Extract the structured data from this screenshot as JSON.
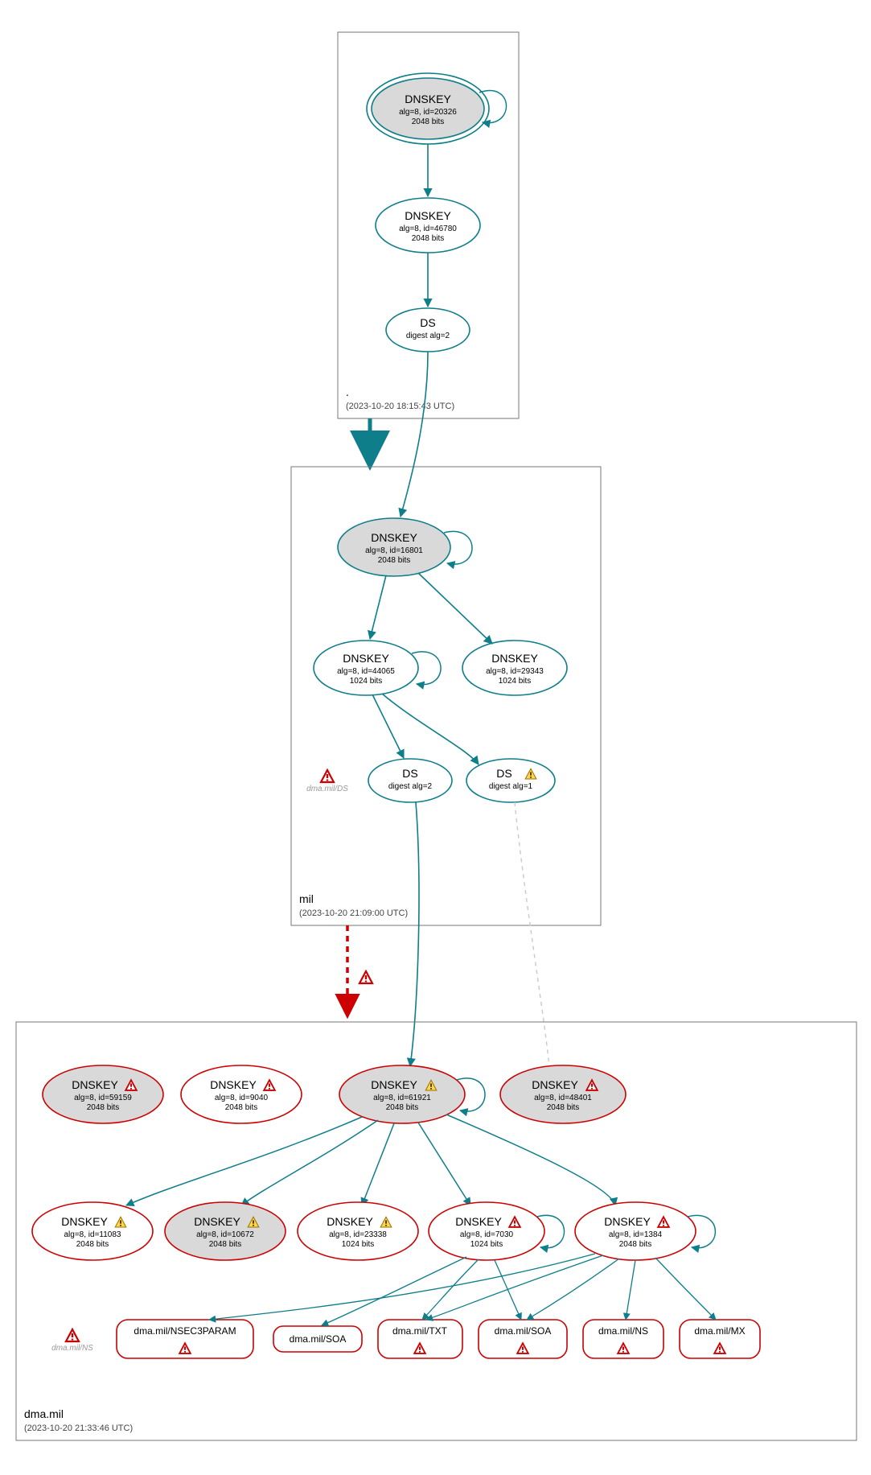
{
  "colors": {
    "teal": "#0d7e8a",
    "red": "#cc0000",
    "greyFill": "#d9d9d9",
    "boxStroke": "#777",
    "lightEdge": "#cccccc"
  },
  "zones": {
    "root": {
      "label": ".",
      "timestamp": "(2023-10-20 18:15:43 UTC)"
    },
    "mil": {
      "label": "mil",
      "timestamp": "(2023-10-20 21:09:00 UTC)"
    },
    "dma": {
      "label": "dma.mil",
      "timestamp": "(2023-10-20 21:33:46 UTC)"
    }
  },
  "nodes": {
    "root_ksk": {
      "title": "DNSKEY",
      "l1": "alg=8, id=20326",
      "l2": "2048 bits"
    },
    "root_zsk": {
      "title": "DNSKEY",
      "l1": "alg=8, id=46780",
      "l2": "2048 bits"
    },
    "root_ds": {
      "title": "DS",
      "l1": "digest alg=2",
      "l2": ""
    },
    "mil_ksk": {
      "title": "DNSKEY",
      "l1": "alg=8, id=16801",
      "l2": "2048 bits"
    },
    "mil_zsk1": {
      "title": "DNSKEY",
      "l1": "alg=8, id=44065",
      "l2": "1024 bits"
    },
    "mil_zsk2": {
      "title": "DNSKEY",
      "l1": "alg=8, id=29343",
      "l2": "1024 bits"
    },
    "mil_ds1": {
      "title": "DS",
      "l1": "digest alg=2",
      "l2": ""
    },
    "mil_ds2": {
      "title": "DS",
      "l1": "digest alg=1",
      "l2": ""
    },
    "mil_err": {
      "text": "dma.mil/DS"
    },
    "dma_k1": {
      "title": "DNSKEY",
      "l1": "alg=8, id=59159",
      "l2": "2048 bits"
    },
    "dma_k2": {
      "title": "DNSKEY",
      "l1": "alg=8, id=9040",
      "l2": "2048 bits"
    },
    "dma_k3": {
      "title": "DNSKEY",
      "l1": "alg=8, id=61921",
      "l2": "2048 bits"
    },
    "dma_k4": {
      "title": "DNSKEY",
      "l1": "alg=8, id=48401",
      "l2": "2048 bits"
    },
    "dma_k5": {
      "title": "DNSKEY",
      "l1": "alg=8, id=11083",
      "l2": "2048 bits"
    },
    "dma_k6": {
      "title": "DNSKEY",
      "l1": "alg=8, id=10672",
      "l2": "2048 bits"
    },
    "dma_k7": {
      "title": "DNSKEY",
      "l1": "alg=8, id=23338",
      "l2": "1024 bits"
    },
    "dma_k8": {
      "title": "DNSKEY",
      "l1": "alg=8, id=7030",
      "l2": "1024 bits"
    },
    "dma_k9": {
      "title": "DNSKEY",
      "l1": "alg=8, id=1384",
      "l2": "2048 bits"
    },
    "dma_err": {
      "text": "dma.mil/NS"
    },
    "rr1": {
      "text": "dma.mil/NSEC3PARAM"
    },
    "rr2": {
      "text": "dma.mil/SOA"
    },
    "rr3": {
      "text": "dma.mil/TXT"
    },
    "rr4": {
      "text": "dma.mil/SOA"
    },
    "rr5": {
      "text": "dma.mil/NS"
    },
    "rr6": {
      "text": "dma.mil/MX"
    }
  }
}
